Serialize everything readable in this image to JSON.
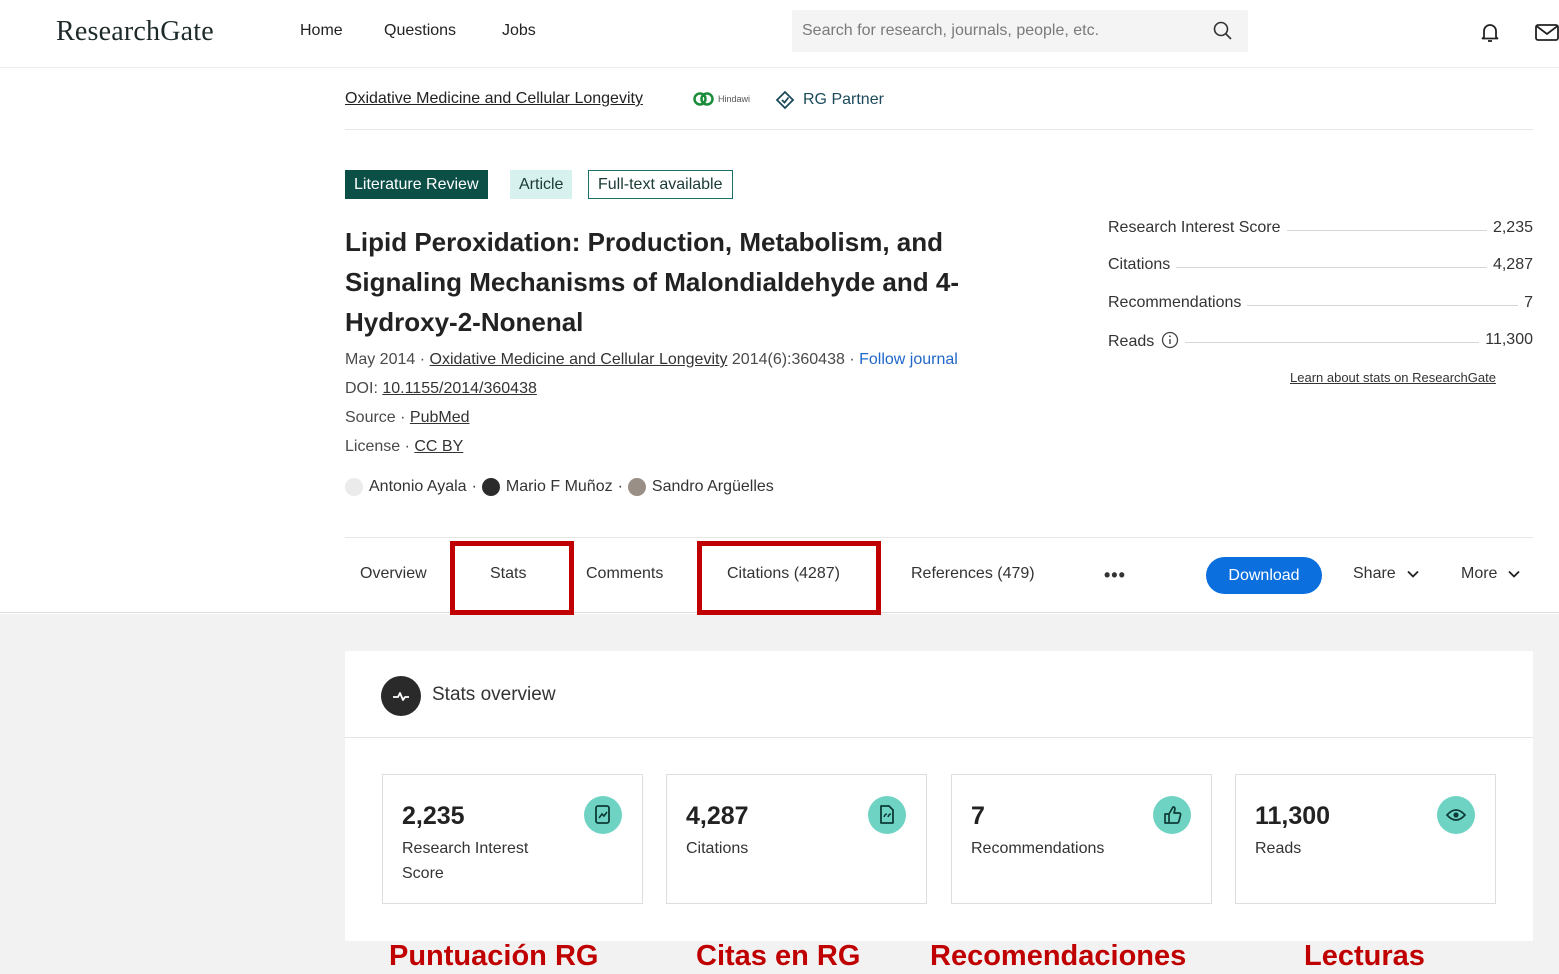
{
  "nav": {
    "logo": "ResearchGate",
    "links": [
      "Home",
      "Questions",
      "Jobs"
    ],
    "search_placeholder": "Search for research, journals, people, etc."
  },
  "journal": {
    "name": "Oxidative Medicine and Cellular Longevity",
    "publisher": "Hindawi",
    "partner": "RG Partner"
  },
  "badges": {
    "review": "Literature Review",
    "article": "Article",
    "fulltext": "Full-text available"
  },
  "article": {
    "title": "Lipid Peroxidation: Production, Metabolism, and Signaling Mechanisms of Malondialdehyde and 4-Hydroxy-2-Nonenal",
    "date": "May 2014 ·",
    "journal_link": "Oxidative Medicine and Cellular Longevity",
    "issue": "2014(6):360438 ·",
    "follow": "Follow journal",
    "doi_label": "DOI:",
    "doi": "10.1155/2014/360438",
    "source_label": "Source ·",
    "source": "PubMed",
    "license_label": "License ·",
    "license": "CC BY",
    "authors": [
      "Antonio Ayala",
      "Mario F Muñoz",
      "Sandro Argüelles"
    ],
    "author_sep": "·"
  },
  "side_stats": {
    "rows": [
      {
        "label": "Research Interest Score",
        "value": "2,235"
      },
      {
        "label": "Citations",
        "value": "4,287"
      },
      {
        "label": "Recommendations",
        "value": "7"
      },
      {
        "label": "Reads",
        "value": "11,300"
      }
    ],
    "learn": "Learn about stats on ResearchGate"
  },
  "tabs": {
    "overview": "Overview",
    "stats": "Stats",
    "comments": "Comments",
    "citations": "Citations (4287)",
    "references": "References (479)",
    "more_dots": "•••",
    "download": "Download",
    "share": "Share",
    "more": "More"
  },
  "stats_overview": {
    "title": "Stats overview",
    "cards": [
      {
        "value": "2,235",
        "label": "Research Interest Score",
        "icon": "research-interest-icon"
      },
      {
        "value": "4,287",
        "label": "Citations",
        "icon": "citation-icon"
      },
      {
        "value": "7",
        "label": "Recommendations",
        "icon": "thumbs-up-icon"
      },
      {
        "value": "11,300",
        "label": "Reads",
        "icon": "eye-icon"
      }
    ]
  },
  "annotations": [
    "Puntuación RG",
    "Citas en RG",
    "Recomendaciones",
    "Lecturas"
  ],
  "colors": {
    "accent_red": "#c00000",
    "primary_blue": "#0c6fde",
    "teal_dark": "#0b4f47",
    "teal_icon": "#6fd3c4"
  }
}
